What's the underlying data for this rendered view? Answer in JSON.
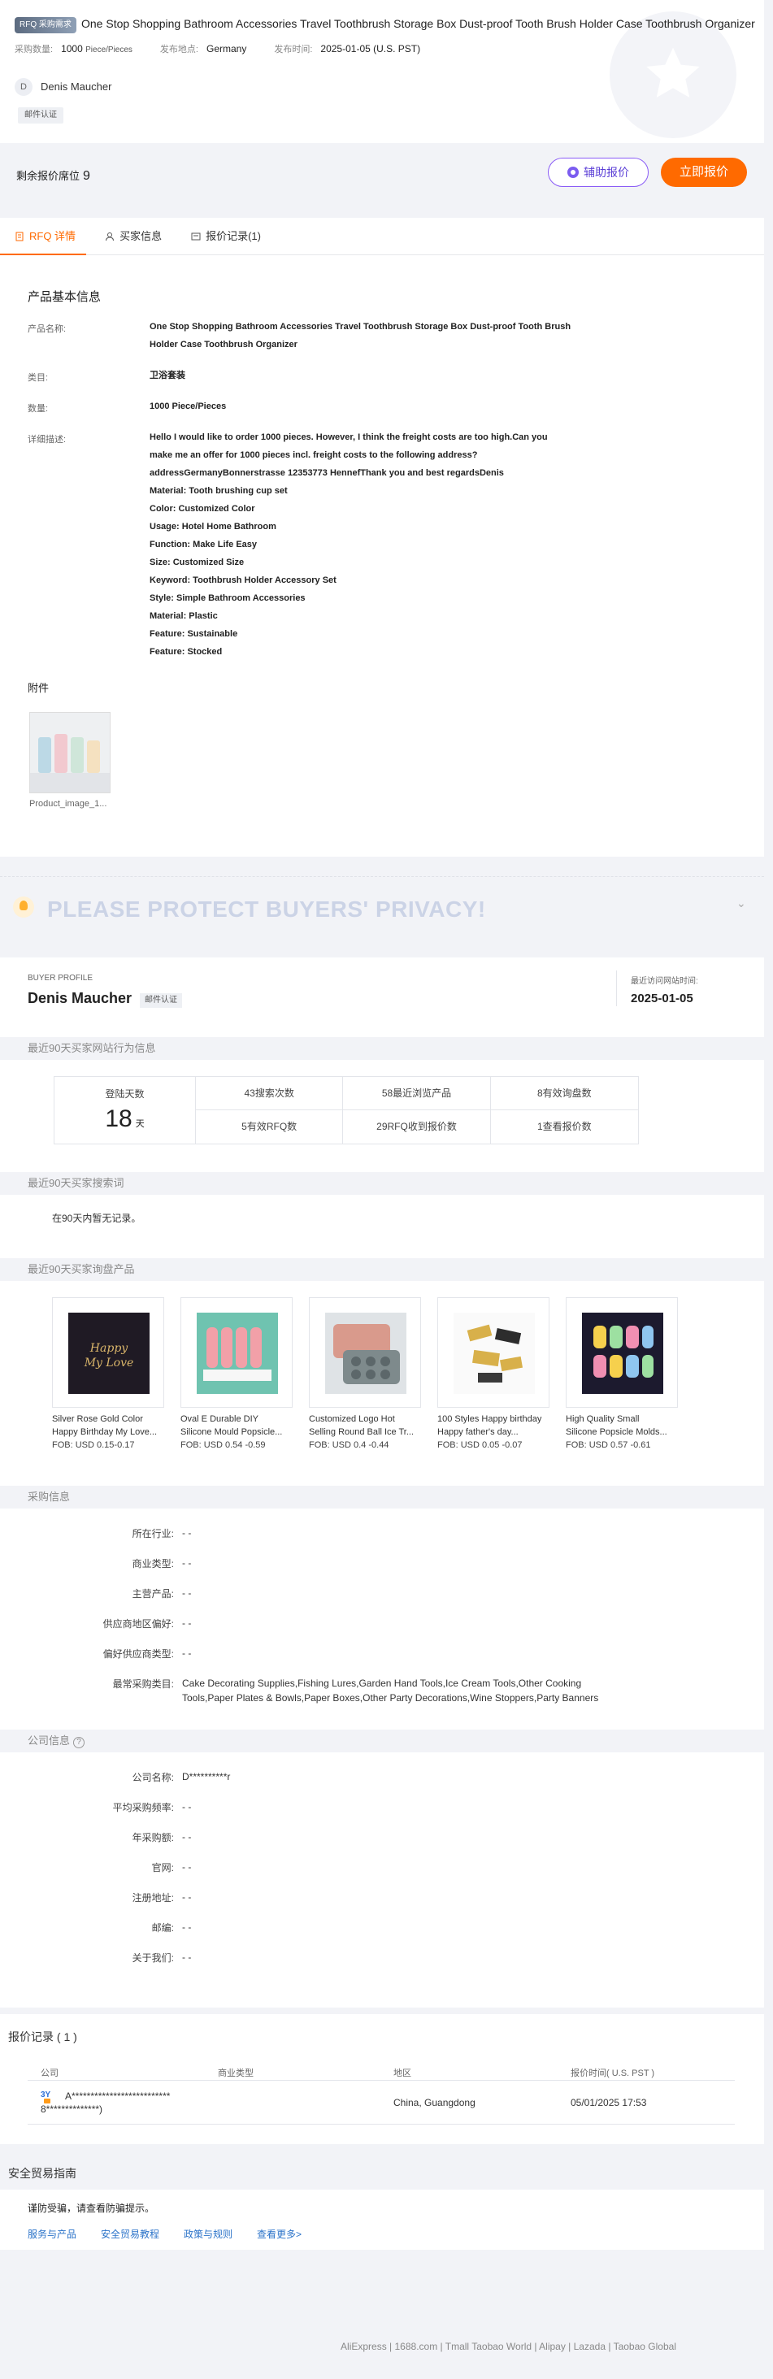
{
  "header": {
    "rfq_badge": "RFQ 采购需求",
    "title": "One Stop Shopping Bathroom Accessories Travel Toothbrush Storage Box Dust-proof Tooth Brush Holder Case Toothbrush Organizer",
    "qty_label": "采购数量:",
    "qty_value": "1000",
    "qty_unit": "Piece/Pieces",
    "origin_label": "发布地点:",
    "origin_value": "Germany",
    "date_label": "发布时间:",
    "date_value": "2025-01-05 (U.S. PST)",
    "avatar_letter": "D",
    "buyer_name": "Denis Maucher",
    "email_tag": "邮件认证",
    "remaining_label": "剩余报价席位",
    "remaining_value": "9",
    "assist_button": "辅助报价",
    "quote_button": "立即报价"
  },
  "tabs": [
    {
      "label": "RFQ 详情"
    },
    {
      "label": "买家信息"
    },
    {
      "label": "报价记录(1)"
    }
  ],
  "details": {
    "section_title": "产品基本信息",
    "name_label": "产品名称:",
    "name_line1": "One Stop Shopping Bathroom Accessories Travel Toothbrush Storage Box Dust-proof Tooth Brush",
    "name_line2": "Holder Case Toothbrush Organizer",
    "category_label": "类目:",
    "category_value": "卫浴套装",
    "qty_label": "数量:",
    "qty_value": "1000 Piece/Pieces",
    "desc_label": "详细描述:",
    "desc_lines": [
      "Hello I would like to order 1000 pieces. However, I think the freight costs are too high.Can you",
      "make me an offer for 1000 pieces incl. freight costs to the following address?",
      "addressGermanyBonnerstrasse 12353773 HennefThank you and best regardsDenis",
      "Material: Tooth brushing cup set",
      "Color: Customized Color",
      "Usage: Hotel Home Bathroom",
      "Function: Make Life Easy",
      "Size: Customized Size",
      "Keyword: Toothbrush Holder Accessory Set",
      "Style: Simple Bathroom Accessories",
      "Material: Plastic",
      "Feature: Sustainable",
      "Feature: Stocked"
    ],
    "attach_title": "附件",
    "attach_name": "Product_image_1..."
  },
  "privacy": {
    "text": "PLEASE PROTECT BUYERS' PRIVACY!"
  },
  "buyer_profile": {
    "label": "BUYER PROFILE",
    "name": "Denis Maucher",
    "tag": "邮件认证",
    "visit_label": "最近访问网站时间:",
    "visit_value": "2025-01-05",
    "activity_title": "最近90天买家网站行为信息",
    "days_label": "登陆天数",
    "days_value": "18",
    "days_unit": "天",
    "stats": [
      "43搜索次数",
      "58最近浏览产品",
      "8有效询盘数",
      "5有效RFQ数",
      "29RFQ收到报价数",
      "1查看报价数"
    ],
    "search_title": "最近90天买家搜索词",
    "no_record": "在90天内暂无记录。",
    "inquiry_title": "最近90天买家询盘产品",
    "products": [
      {
        "name1": "Silver Rose Gold Color",
        "name2": "Happy Birthday My Love...",
        "price": "FOB: USD 0.15-0.17"
      },
      {
        "name1": "Oval E Durable DIY",
        "name2": "Silicone Mould Popsicle...",
        "price": "FOB: USD 0.54 -0.59"
      },
      {
        "name1": "Customized Logo Hot",
        "name2": "Selling Round Ball Ice Tr...",
        "price": "FOB: USD 0.4 -0.44"
      },
      {
        "name1": "100 Styles Happy birthday",
        "name2": "Happy father's day...",
        "price": "FOB: USD 0.05 -0.07"
      },
      {
        "name1": "High Quality Small",
        "name2": "Silicone Popsicle Molds...",
        "price": "FOB: USD 0.57 -0.61"
      }
    ],
    "procure_title": "采购信息",
    "procure": [
      {
        "k": "所在行业:",
        "v": "- -"
      },
      {
        "k": "商业类型:",
        "v": "- -"
      },
      {
        "k": "主营产品:",
        "v": "- -"
      },
      {
        "k": "供应商地区偏好:",
        "v": "- -"
      },
      {
        "k": "偏好供应商类型:",
        "v": "- -"
      },
      {
        "k": "最常采购类目:",
        "v": "Cake Decorating Supplies,Fishing Lures,Garden Hand Tools,Ice Cream Tools,Other Cooking",
        "v2": "Tools,Paper Plates & Bowls,Paper Boxes,Other Party Decorations,Wine Stoppers,Party Banners"
      }
    ],
    "company_title": "公司信息",
    "company": [
      {
        "k": "公司名称:",
        "v": "D**********r"
      },
      {
        "k": "平均采购频率:",
        "v": "- -"
      },
      {
        "k": "年采购额:",
        "v": "- -"
      },
      {
        "k": "官网:",
        "v": "- -"
      },
      {
        "k": "注册地址:",
        "v": "- -"
      },
      {
        "k": "邮编:",
        "v": "- -"
      },
      {
        "k": "关于我们:",
        "v": "- -"
      }
    ]
  },
  "quote_records": {
    "title": "报价记录 ( 1 )",
    "headers": [
      "公司",
      "商业类型",
      "地区",
      "报价时间( U.S. PST )"
    ],
    "row": {
      "logo_text": "3Y",
      "company_line1": "A**************************",
      "company_line2": "8**************)",
      "region": "China, Guangdong",
      "time": "05/01/2025 17:53"
    }
  },
  "safe": {
    "title": "安全贸易指南",
    "tip": "谨防受骗，请查看防骗提示。",
    "links": [
      "服务与产品",
      "安全贸易教程",
      "政策与规则",
      "查看更多>"
    ]
  },
  "footer": {
    "text": "AliExpress | 1688.com | Tmall Taobao World | Alipay | Lazada | Taobao Global"
  }
}
